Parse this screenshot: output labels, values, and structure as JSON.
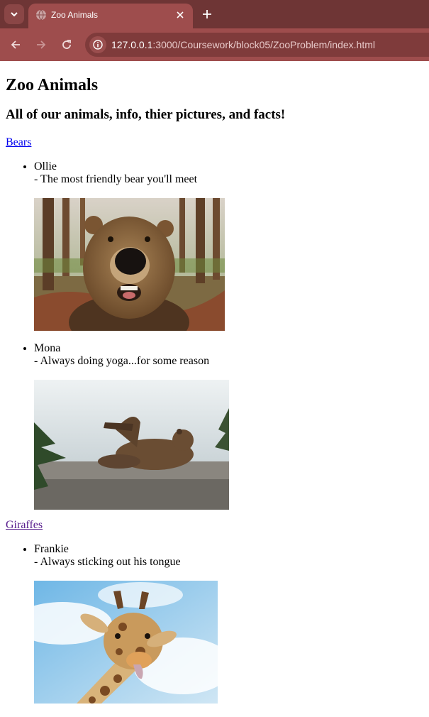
{
  "browser": {
    "tab_title": "Zoo Animals",
    "url_host": "127.0.0.1",
    "url_rest": ":3000/Coursework/block05/ZooProblem/index.html"
  },
  "page": {
    "title": "Zoo Animals",
    "subtitle": "All of our animals, info, thier pictures, and facts!",
    "categories": [
      {
        "link": "Bears",
        "animals": [
          {
            "name": "Ollie",
            "fact": "- The most friendly bear you'll meet",
            "image": "bear-selfie-photo"
          },
          {
            "name": "Mona",
            "fact": "- Always doing yoga...for some reason",
            "image": "bear-yoga-photo"
          }
        ]
      },
      {
        "link": "Giraffes",
        "animals": [
          {
            "name": "Frankie",
            "fact": "- Always sticking out his tongue",
            "image": "giraffe-tongue-photo"
          }
        ]
      }
    ]
  }
}
